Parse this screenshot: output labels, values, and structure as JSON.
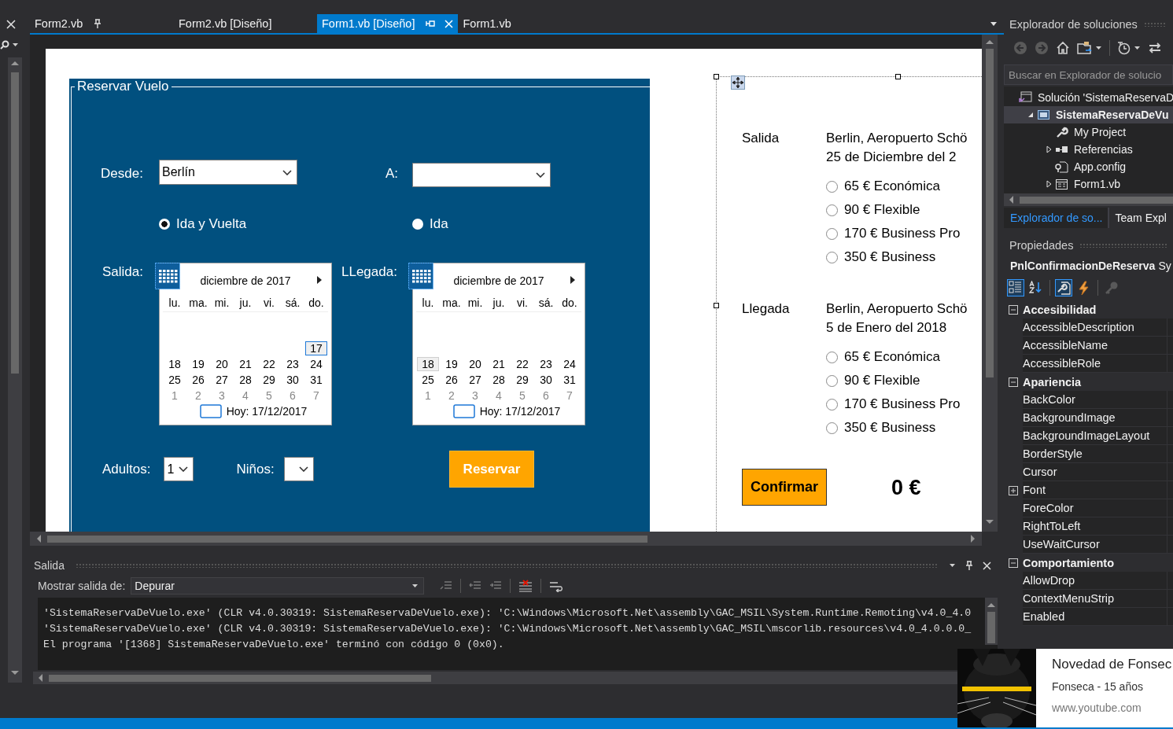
{
  "tabs": [
    {
      "label": "Form2.vb",
      "selected": false,
      "pinned": true
    },
    {
      "label": "Form2.vb [Diseño]",
      "selected": false,
      "pinned": false
    },
    {
      "label": "Form1.vb [Diseño]",
      "selected": true,
      "pinned": false
    },
    {
      "label": "Form1.vb",
      "selected": false,
      "pinned": false
    }
  ],
  "designer": {
    "group_title": "Reservar Vuelo",
    "from": {
      "label": "Desde:",
      "value": "Berlín"
    },
    "to": {
      "label": "A:"
    },
    "trip_types": [
      {
        "label": "Ida y Vuelta",
        "selected": true
      },
      {
        "label": "Ida",
        "selected": false
      }
    ],
    "calendars": [
      {
        "label": "Salida:",
        "month": "diciembre de 2017",
        "weekdays": [
          "lu.",
          "ma.",
          "mi.",
          "ju.",
          "vi.",
          "sá.",
          "do."
        ],
        "today": "Hoy: 17/12/2017",
        "weeks": [
          [
            {
              "kind": "blank"
            },
            {
              "kind": "blank"
            },
            {
              "kind": "blank"
            },
            {
              "kind": "blank"
            },
            {
              "kind": "blank"
            },
            {
              "kind": "blank"
            },
            {
              "kind": "day",
              "d": "17",
              "selected": true,
              "today": true
            }
          ],
          [
            {
              "kind": "day",
              "d": "18",
              "selected": false,
              "today": false
            },
            {
              "kind": "day",
              "d": "19",
              "selected": false,
              "today": false
            },
            {
              "kind": "day",
              "d": "20",
              "selected": false,
              "today": false
            },
            {
              "kind": "day",
              "d": "21",
              "selected": false,
              "today": false
            },
            {
              "kind": "day",
              "d": "22",
              "selected": false,
              "today": false
            },
            {
              "kind": "day",
              "d": "23",
              "selected": false,
              "today": false
            },
            {
              "kind": "day",
              "d": "24",
              "selected": false,
              "today": false
            }
          ],
          [
            {
              "kind": "day",
              "d": "25",
              "selected": false,
              "today": false
            },
            {
              "kind": "day",
              "d": "26",
              "selected": false,
              "today": false
            },
            {
              "kind": "day",
              "d": "27",
              "selected": false,
              "today": false
            },
            {
              "kind": "day",
              "d": "28",
              "selected": false,
              "today": false
            },
            {
              "kind": "day",
              "d": "29",
              "selected": false,
              "today": false
            },
            {
              "kind": "day",
              "d": "30",
              "selected": false,
              "today": false
            },
            {
              "kind": "day",
              "d": "31",
              "selected": false,
              "today": false
            }
          ],
          [
            {
              "kind": "other",
              "d": "1"
            },
            {
              "kind": "other",
              "d": "2"
            },
            {
              "kind": "other",
              "d": "3"
            },
            {
              "kind": "other",
              "d": "4"
            },
            {
              "kind": "other",
              "d": "5"
            },
            {
              "kind": "other",
              "d": "6"
            },
            {
              "kind": "other",
              "d": "7"
            }
          ]
        ]
      },
      {
        "label": "LLegada:",
        "month": "diciembre de 2017",
        "weekdays": [
          "lu.",
          "ma.",
          "mi.",
          "ju.",
          "vi.",
          "sá.",
          "do."
        ],
        "today": "Hoy: 17/12/2017",
        "weeks": [
          [
            {
              "kind": "blank"
            },
            {
              "kind": "blank"
            },
            {
              "kind": "blank"
            },
            {
              "kind": "blank"
            },
            {
              "kind": "blank"
            },
            {
              "kind": "blank"
            },
            {
              "kind": "blank"
            }
          ],
          [
            {
              "kind": "day",
              "d": "18",
              "selected": true,
              "today": false
            },
            {
              "kind": "day",
              "d": "19",
              "selected": false,
              "today": false
            },
            {
              "kind": "day",
              "d": "20",
              "selected": false,
              "today": false
            },
            {
              "kind": "day",
              "d": "21",
              "selected": false,
              "today": false
            },
            {
              "kind": "day",
              "d": "22",
              "selected": false,
              "today": false
            },
            {
              "kind": "day",
              "d": "23",
              "selected": false,
              "today": false
            },
            {
              "kind": "day",
              "d": "24",
              "selected": false,
              "today": false
            }
          ],
          [
            {
              "kind": "day",
              "d": "25",
              "selected": false,
              "today": false
            },
            {
              "kind": "day",
              "d": "26",
              "selected": false,
              "today": false
            },
            {
              "kind": "day",
              "d": "27",
              "selected": false,
              "today": false
            },
            {
              "kind": "day",
              "d": "28",
              "selected": false,
              "today": false
            },
            {
              "kind": "day",
              "d": "29",
              "selected": false,
              "today": false
            },
            {
              "kind": "day",
              "d": "30",
              "selected": false,
              "today": false
            },
            {
              "kind": "day",
              "d": "31",
              "selected": false,
              "today": false
            }
          ],
          [
            {
              "kind": "other",
              "d": "1"
            },
            {
              "kind": "other",
              "d": "2"
            },
            {
              "kind": "other",
              "d": "3"
            },
            {
              "kind": "other",
              "d": "4"
            },
            {
              "kind": "other",
              "d": "5"
            },
            {
              "kind": "other",
              "d": "6"
            },
            {
              "kind": "other",
              "d": "7"
            }
          ]
        ]
      }
    ],
    "adults": {
      "label": "Adultos:",
      "value": "1"
    },
    "kids": {
      "label": "Niños:"
    },
    "book_button": "Reservar",
    "confirmation": {
      "sections": [
        {
          "label": "Salida",
          "lines": [
            "Berlin, Aeropuerto Schö",
            "25 de Diciembre del 2"
          ],
          "fares": [
            {
              "label": "65 € Económica",
              "selected": false
            },
            {
              "label": "90 € Flexible",
              "selected": false
            },
            {
              "label": "170 € Business Pro",
              "selected": false
            },
            {
              "label": "350 € Business",
              "selected": false
            }
          ]
        },
        {
          "label": "Llegada",
          "lines": [
            "Berlin, Aeropuerto Schö",
            "5 de Enero del 2018"
          ],
          "fares": [
            {
              "label": "65 € Económica",
              "selected": false
            },
            {
              "label": "90 € Flexible",
              "selected": false
            },
            {
              "label": "170 € Business Pro",
              "selected": false
            },
            {
              "label": "350 € Business",
              "selected": false
            }
          ]
        }
      ],
      "confirm_button": "Confirmar",
      "total": "0 €"
    }
  },
  "output": {
    "title": "Salida",
    "source_label": "Mostrar salida de:",
    "source": "Depurar",
    "lines": [
      "'SistemaReservaDeVuelo.exe' (CLR v4.0.30319: SistemaReservaDeVuelo.exe): 'C:\\Windows\\Microsoft.Net\\assembly\\GAC_MSIL\\System.Runtime.Remoting\\v4.0_4.0",
      "'SistemaReservaDeVuelo.exe' (CLR v4.0.30319: SistemaReservaDeVuelo.exe): 'C:\\Windows\\Microsoft.Net\\assembly\\GAC_MSIL\\mscorlib.resources\\v4.0_4.0.0.0_",
      "El programa '[1368] SistemaReservaDeVuelo.exe' terminó con código 0 (0x0)."
    ]
  },
  "solution_explorer": {
    "title": "Explorador de soluciones",
    "search": {
      "placeholder": "Buscar en Explorador de solucio"
    },
    "tree": [
      {
        "label": "Solución 'SistemaReservaD",
        "kind": "solution",
        "selected": false,
        "children": [
          {
            "label": "SistemaReservaDeVu",
            "kind": "project",
            "expanded": true,
            "selected": true,
            "children": [
              {
                "label": "My Project",
                "kind": "settings",
                "selected": false
              },
              {
                "label": "Referencias",
                "kind": "references",
                "expanded": false,
                "selected": false
              },
              {
                "label": "App.config",
                "kind": "config",
                "selected": false
              },
              {
                "label": "Form1.vb",
                "kind": "form",
                "expanded": false,
                "selected": false
              }
            ]
          }
        ]
      }
    ],
    "tabs": [
      {
        "label": "Explorador de so...",
        "selected": true
      },
      {
        "label": "Team Expl",
        "selected": false
      }
    ]
  },
  "properties": {
    "title": "Propiedades",
    "object": "PnlConfirmacionDeReserva",
    "object_type": "Sy",
    "tool_buttons": [
      {
        "kind": "categorized",
        "selected": true,
        "disabled": false
      },
      {
        "kind": "alphabetical",
        "selected": false,
        "disabled": false
      },
      {
        "kind": "properties",
        "selected": true,
        "disabled": false
      },
      {
        "kind": "events",
        "selected": false,
        "disabled": false
      },
      {
        "kind": "pages",
        "selected": false,
        "disabled": true
      }
    ],
    "categories": [
      {
        "name": "Accesibilidad",
        "expanded": true,
        "rows": [
          {
            "name": "AccessibleDescription",
            "expandable": false
          },
          {
            "name": "AccessibleName",
            "expandable": false
          },
          {
            "name": "AccessibleRole",
            "expandable": false
          }
        ]
      },
      {
        "name": "Apariencia",
        "expanded": true,
        "rows": [
          {
            "name": "BackColor",
            "expandable": false
          },
          {
            "name": "BackgroundImage",
            "expandable": false
          },
          {
            "name": "BackgroundImageLayout",
            "expandable": false
          },
          {
            "name": "BorderStyle",
            "expandable": false
          },
          {
            "name": "Cursor",
            "expandable": false
          },
          {
            "name": "Font",
            "expandable": true
          },
          {
            "name": "ForeColor",
            "expandable": false
          },
          {
            "name": "RightToLeft",
            "expandable": false
          },
          {
            "name": "UseWaitCursor",
            "expandable": false
          }
        ]
      },
      {
        "name": "Comportamiento",
        "expanded": true,
        "rows": [
          {
            "name": "AllowDrop",
            "expandable": false
          },
          {
            "name": "ContextMenuStrip",
            "expandable": false
          },
          {
            "name": "Enabled",
            "expandable": false
          }
        ]
      }
    ]
  },
  "toast": {
    "title": "Novedad de Fonsec",
    "subtitle": "Fonseca - 15 años",
    "source": "www.youtube.com"
  }
}
